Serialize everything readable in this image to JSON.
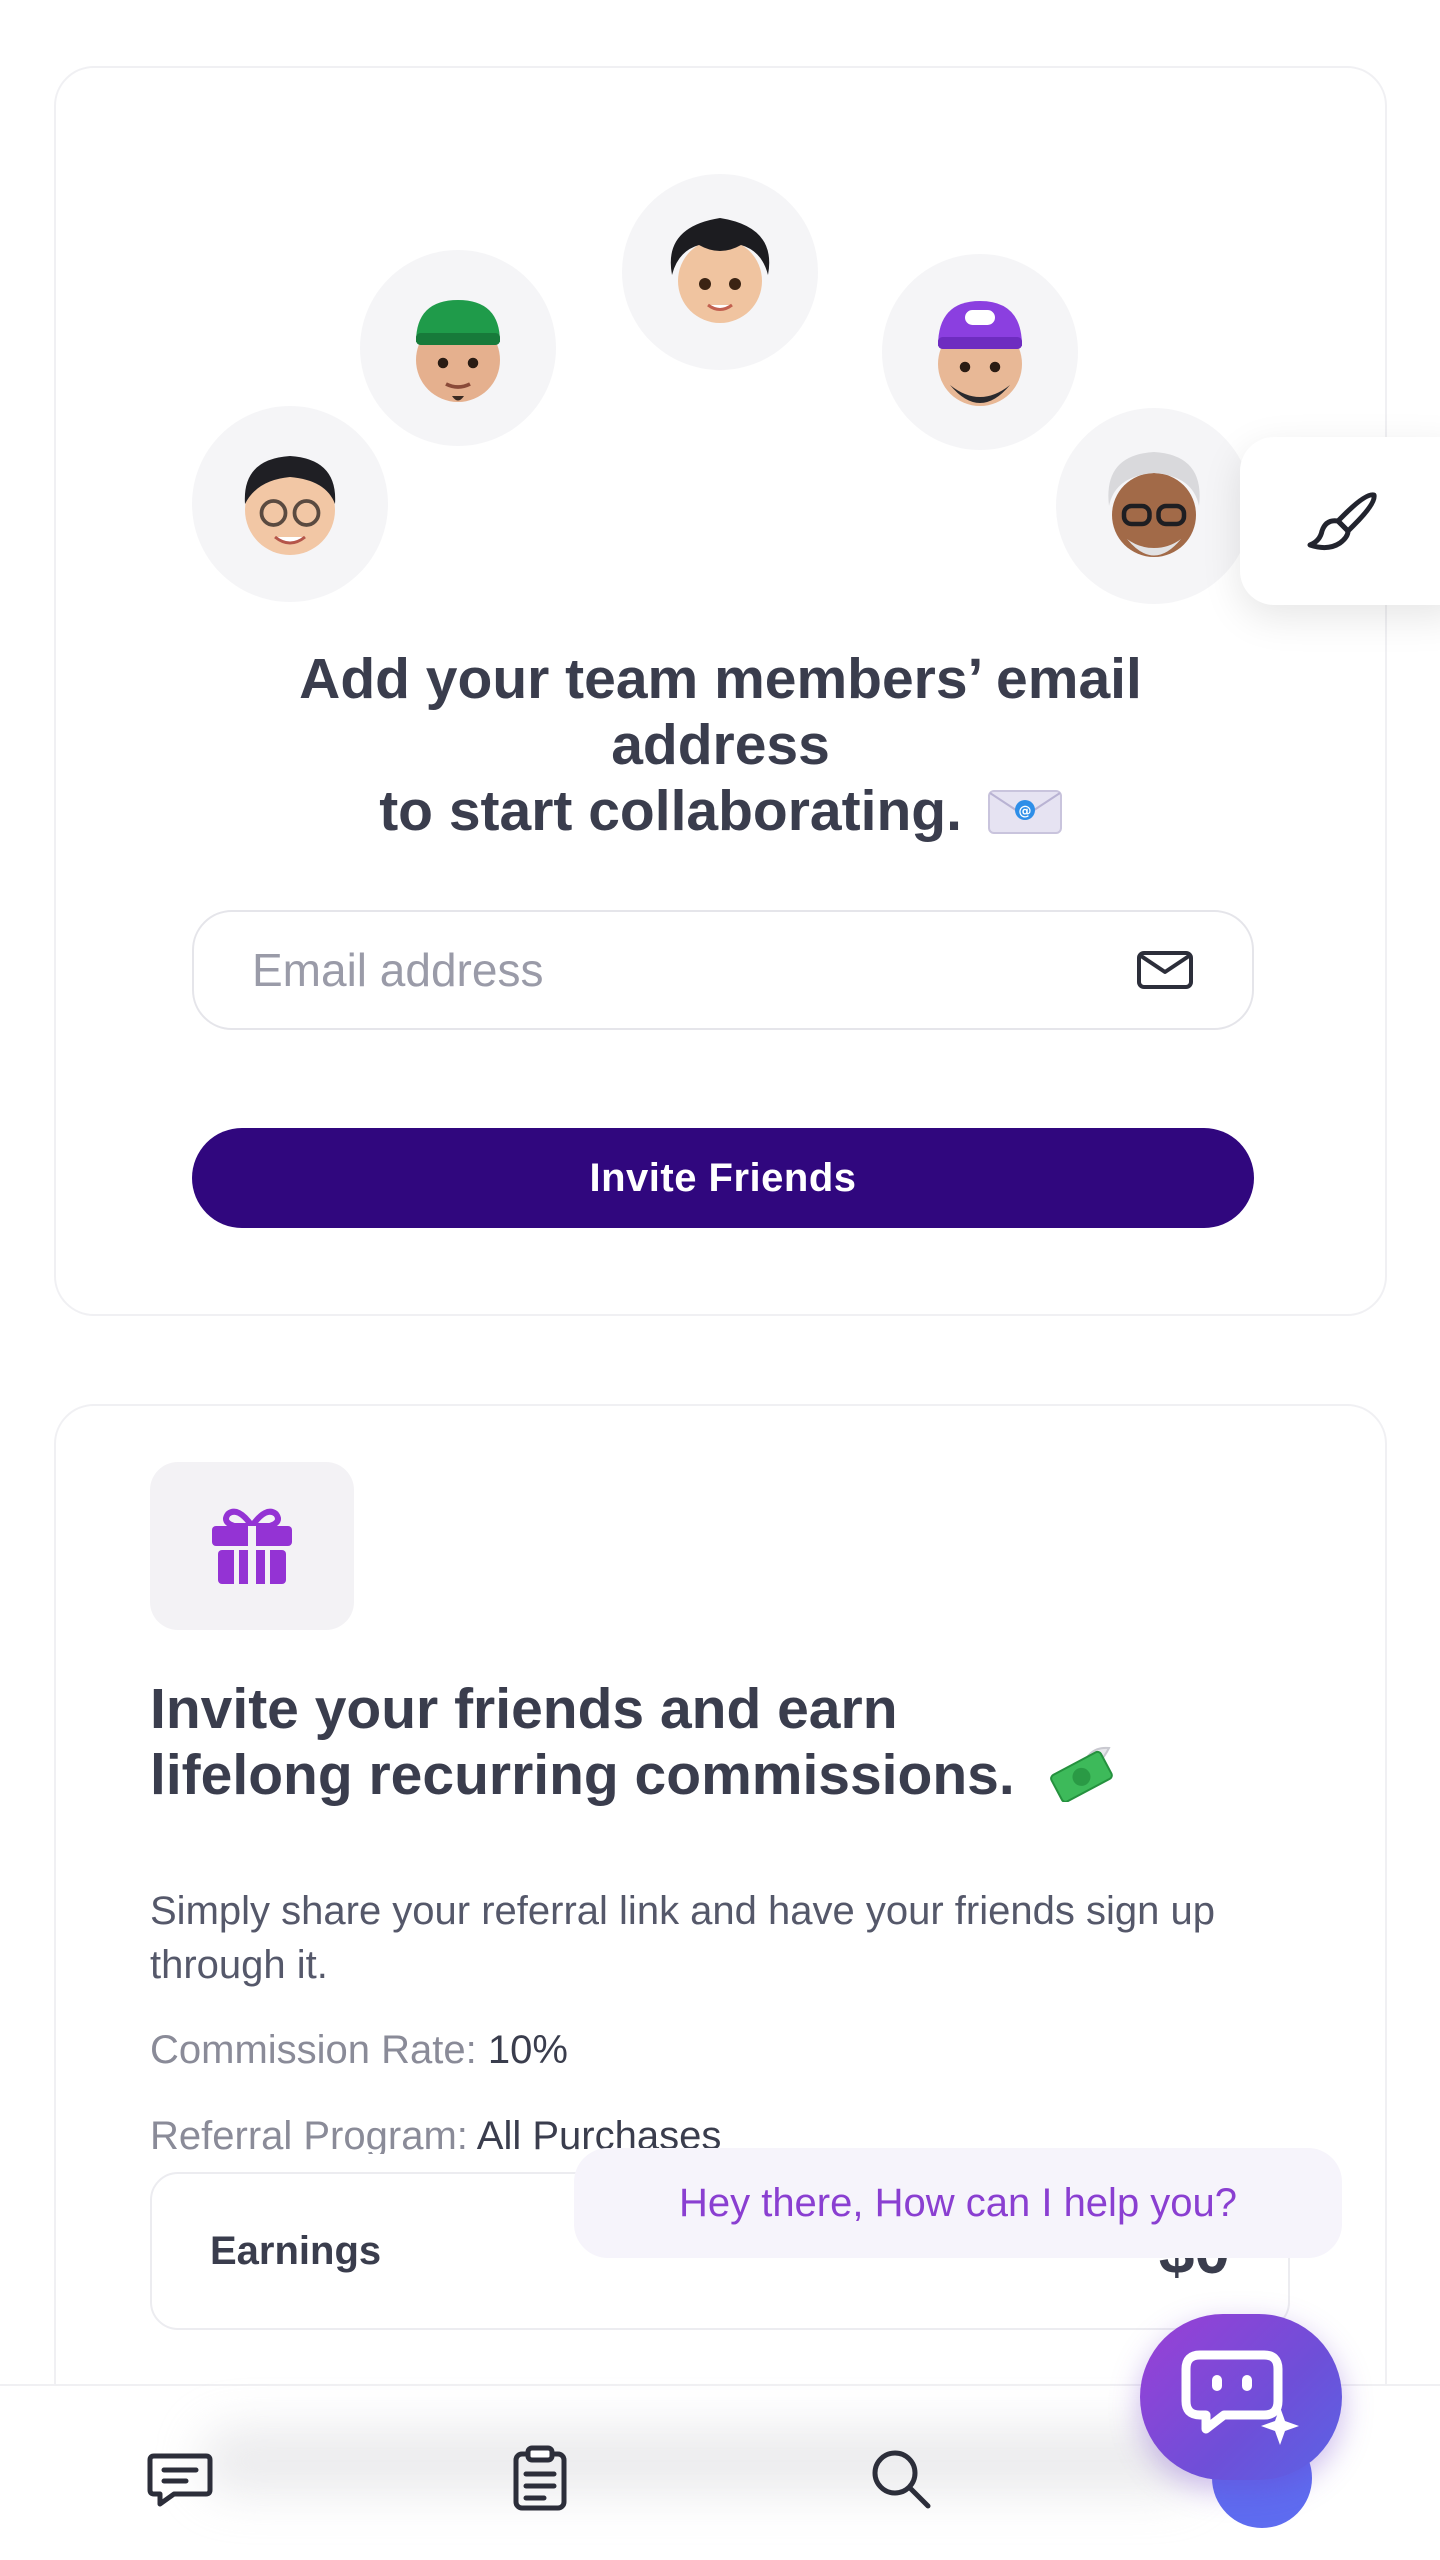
{
  "invite": {
    "heading_line1": "Add your team members’ email",
    "heading_line2": "address",
    "heading_line3": "to start collaborating.",
    "email_placeholder": "Email address",
    "email_value": "",
    "invite_button_label": "Invite Friends"
  },
  "avatars": [
    {
      "name": "avatar-woman-glasses"
    },
    {
      "name": "avatar-man-green-cap"
    },
    {
      "name": "avatar-curly-hair"
    },
    {
      "name": "avatar-man-purple-cap"
    },
    {
      "name": "avatar-older-man-glasses"
    }
  ],
  "referral": {
    "title_line1": "Invite your friends and earn",
    "title_line2": "lifelong recurring commissions.",
    "description": "Simply share your referral link and have your friends sign up through it.",
    "commission_label": "Commission Rate:",
    "commission_value": "10%",
    "program_label": "Referral Program:",
    "program_value": "All Purchases",
    "earnings_label": "Earnings",
    "earnings_value": "$0"
  },
  "chat": {
    "bubble_text": "Hey there, How can I help you?"
  },
  "icons": {
    "brush": "paint-brush-icon",
    "gift": "gift-icon",
    "mail": "mail-icon",
    "chat": "chat-icon",
    "tasks": "clipboard-icon",
    "search": "search-icon",
    "ai": "ai-bot-icon"
  },
  "colors": {
    "primary_button": "#30077e",
    "accent_purple": "#8a3fd1",
    "text_dark": "#3a3d4d"
  }
}
